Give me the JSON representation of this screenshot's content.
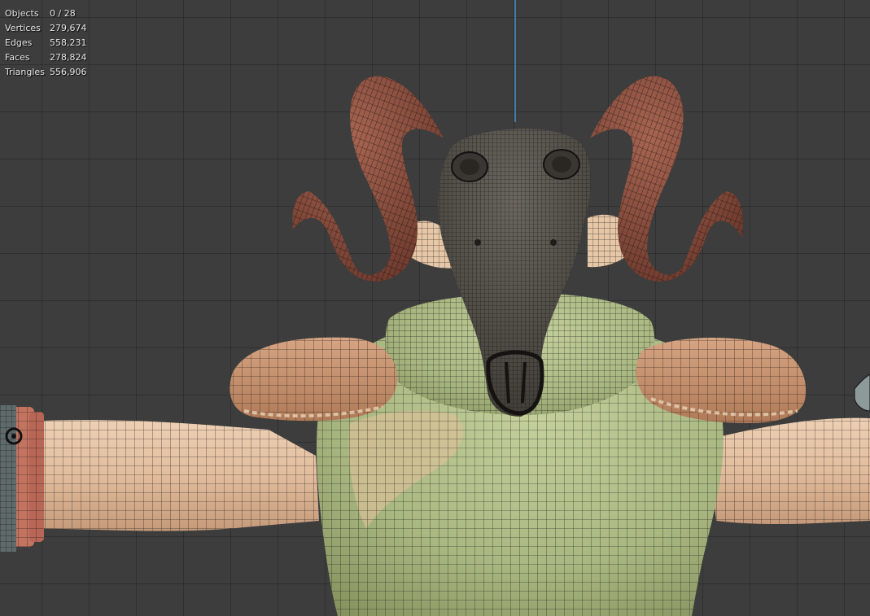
{
  "stats": [
    {
      "key": "objects",
      "label": "Objects",
      "value": "0 / 28"
    },
    {
      "key": "vertices",
      "label": "Vertices",
      "value": "279,674"
    },
    {
      "key": "edges",
      "label": "Edges",
      "value": "558,231"
    },
    {
      "key": "faces",
      "label": "Faces",
      "value": "278,824"
    },
    {
      "key": "triangles",
      "label": "Triangles",
      "value": "556,906"
    }
  ],
  "colors": {
    "background": "#3d3d3d",
    "axis_line": "#4a8fd0",
    "horn": "#8a5042",
    "skull": "#545049",
    "skin": "#dcb89a",
    "shirt": "#aebd86",
    "shoulder_pad": "#c08a68",
    "bracer": "#c37461",
    "wireframe": "#1a1a1a"
  }
}
